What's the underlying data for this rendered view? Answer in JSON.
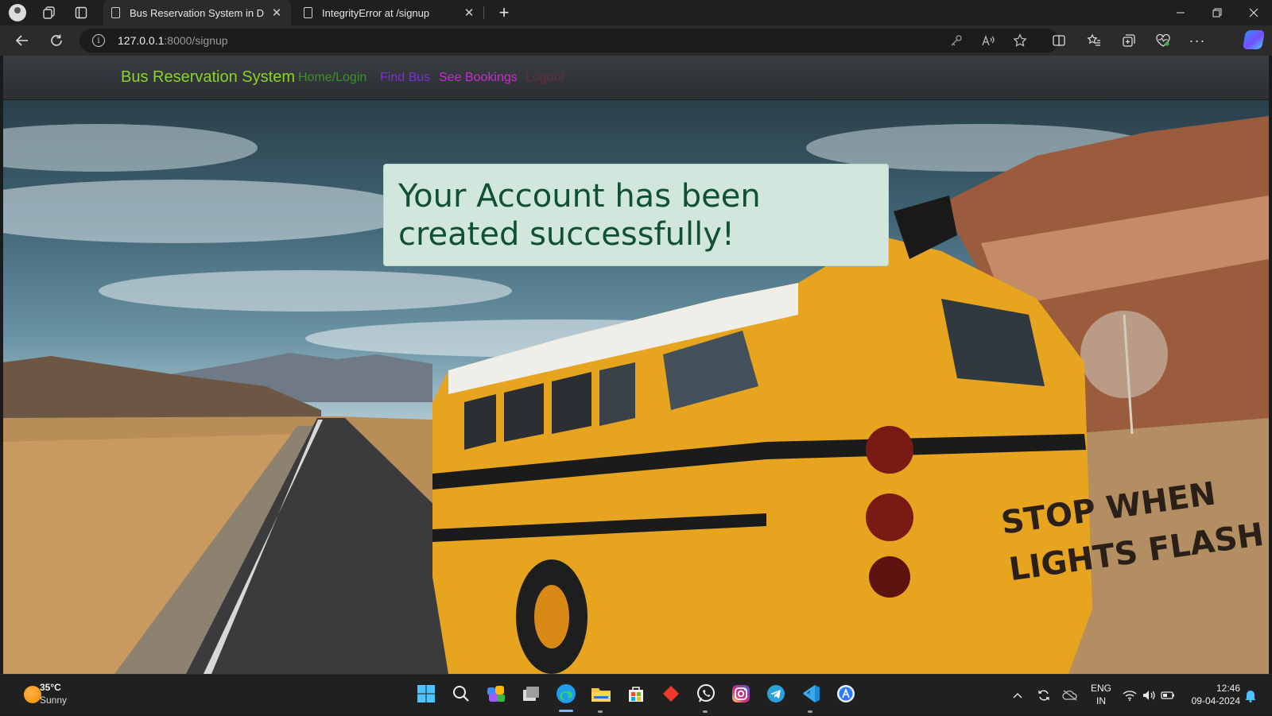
{
  "browser": {
    "tabs": [
      {
        "title": "Bus Reservation System in Djang",
        "active": true
      },
      {
        "title": "IntegrityError at /signup",
        "active": false
      }
    ],
    "url_host": "127.0.0.1",
    "url_rest": ":8000/signup"
  },
  "site": {
    "brand": "Bus Reservation System",
    "nav": [
      {
        "label": "Home/Login",
        "color": "#3c8f2a"
      },
      {
        "label": "Find Bus",
        "color": "#7a2fd6"
      },
      {
        "label": "See Bookings",
        "color": "#c92bd0"
      },
      {
        "label": "Logout",
        "color": "#6a2b3a"
      }
    ],
    "alert": "Your Account has been created successfully!"
  },
  "taskbar": {
    "weather_temp": "35°C",
    "weather_desc": "Sunny",
    "lang_top": "ENG",
    "lang_bottom": "IN",
    "time": "12:46",
    "date": "09-04-2024"
  }
}
